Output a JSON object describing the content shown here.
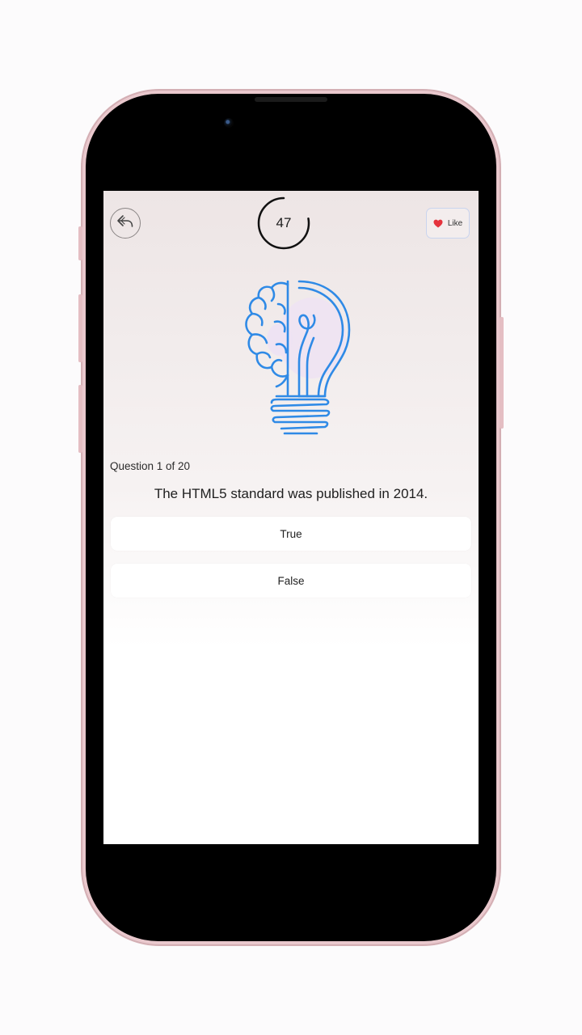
{
  "header": {
    "timer_value": "47",
    "timer_progress": 0.78,
    "like_label": "Like",
    "back_icon": "reply-arrow-icon",
    "like_icon": "heart-icon"
  },
  "hero": {
    "icon": "brain-lightbulb-icon"
  },
  "quiz": {
    "counter": "Question 1 of 20",
    "question": "The HTML5 standard was published in 2014.",
    "options": [
      {
        "label": "True"
      },
      {
        "label": "False"
      }
    ]
  },
  "colors": {
    "accent_blue": "#2f8ae6",
    "heart_red": "#e5333d",
    "frame_pink": "#e9c8cd"
  }
}
